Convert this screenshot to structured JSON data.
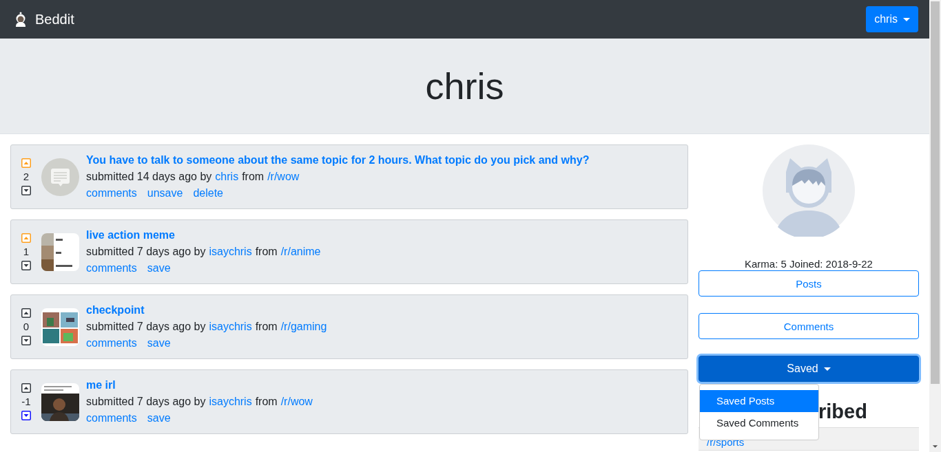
{
  "navbar": {
    "brand": "Beddit",
    "user_menu": {
      "label": "chris"
    }
  },
  "header": {
    "title": "chris"
  },
  "posts": [
    {
      "upvoted": true,
      "downvoted": false,
      "score": "2",
      "kind": "text",
      "title": "You have to talk to someone about the same topic for 2 hours. What topic do you pick and why?",
      "submitted": "submitted 14 days ago by",
      "author": "chris",
      "from": "from",
      "subreddit": "/r/wow",
      "actions": [
        "comments",
        "unsave",
        "delete"
      ]
    },
    {
      "upvoted": true,
      "downvoted": false,
      "score": "1",
      "title": "live action meme",
      "submitted": "submitted 7 days ago by",
      "author": "isaychris",
      "from": "from",
      "subreddit": "/r/anime",
      "actions": [
        "comments",
        "save"
      ]
    },
    {
      "upvoted": false,
      "downvoted": false,
      "score": "0",
      "title": "checkpoint",
      "submitted": "submitted 7 days ago by",
      "author": "isaychris",
      "from": "from",
      "subreddit": "/r/gaming",
      "actions": [
        "comments",
        "save"
      ]
    },
    {
      "upvoted": false,
      "downvoted": true,
      "score": "-1",
      "title": "me irl",
      "submitted": "submitted 7 days ago by",
      "author": "isaychris",
      "from": "from",
      "subreddit": "/r/wow",
      "actions": [
        "comments",
        "save"
      ]
    }
  ],
  "sidebar": {
    "karma": "Karma: 5 Joined: 2018-9-22",
    "buttons": [
      {
        "kind": "link",
        "label": "Posts"
      },
      {
        "kind": "link",
        "label": "Comments"
      },
      {
        "kind": "dropdown",
        "label": "Saved",
        "expanded": true,
        "menu": [
          {
            "label": "Saved Posts",
            "selected": true
          },
          {
            "label": "Saved Comments",
            "selected": false
          }
        ]
      }
    ],
    "subscribed_heading": "ribed",
    "subscriptions": [
      "/r/sports"
    ]
  }
}
